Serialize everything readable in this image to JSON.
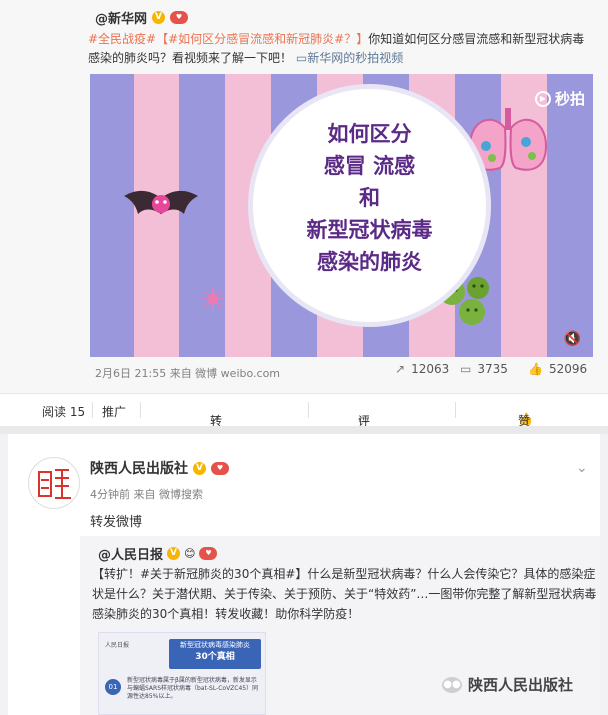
{
  "post1": {
    "author": "@新华网",
    "hashtag": "#全民战疫#",
    "topic": "【#如何区分感冒流感和新冠肺炎#？】",
    "body": "你知道如何区分感冒流感和新型冠状病毒感染的肺炎吗？看视频来了解一下吧！",
    "video_link": "新华网的秒拍视频",
    "video": {
      "watermark": "秒拍",
      "title_lines": [
        "如何区分",
        "感冒 流感",
        "和",
        "新型冠状病毒",
        "感染的肺炎"
      ]
    },
    "meta": "2月6日 21:55 来自 微博 weibo.com",
    "reposts": "12063",
    "comments": "3735",
    "likes": "52096"
  },
  "actionbar": {
    "read_label": "阅读 15",
    "promote_label": "推广",
    "forward_label": "转发",
    "comment_label": "评论",
    "like_label": "赞"
  },
  "post2": {
    "author": "陕西人民出版社",
    "meta": "4分钟前 来自 微博搜索",
    "body": "转发微博",
    "repost": {
      "author": "@人民日报",
      "text": "【转扩！#关于新冠肺炎的30个真相#】什么是新型冠状病毒？什么人会传染它？具体的感染症状是什么？关于潜伏期、关于传染、关于预防、关于“特效药”…一图带你完整了解新型冠状病毒感染肺炎的30个真相！转发收藏！助你科学防疫！",
      "thumb_title": "新型冠状病毒感染肺炎",
      "thumb_subtitle": "30个真相",
      "thumb_logo": "人民日报",
      "thumb_num": "01",
      "thumb_text": "新型冠状病毒属于β属的新型冠状病毒，新发显示与蝙蝠SARS样冠状病毒（bat-SL-CoVZC45）同源性达85%以上。"
    }
  },
  "watermark": "陕西人民出版社",
  "colors": {
    "accent": "#eb7350",
    "link": "#5d7895",
    "badge": "#f7b500",
    "video_purple": "#5b2a86"
  }
}
